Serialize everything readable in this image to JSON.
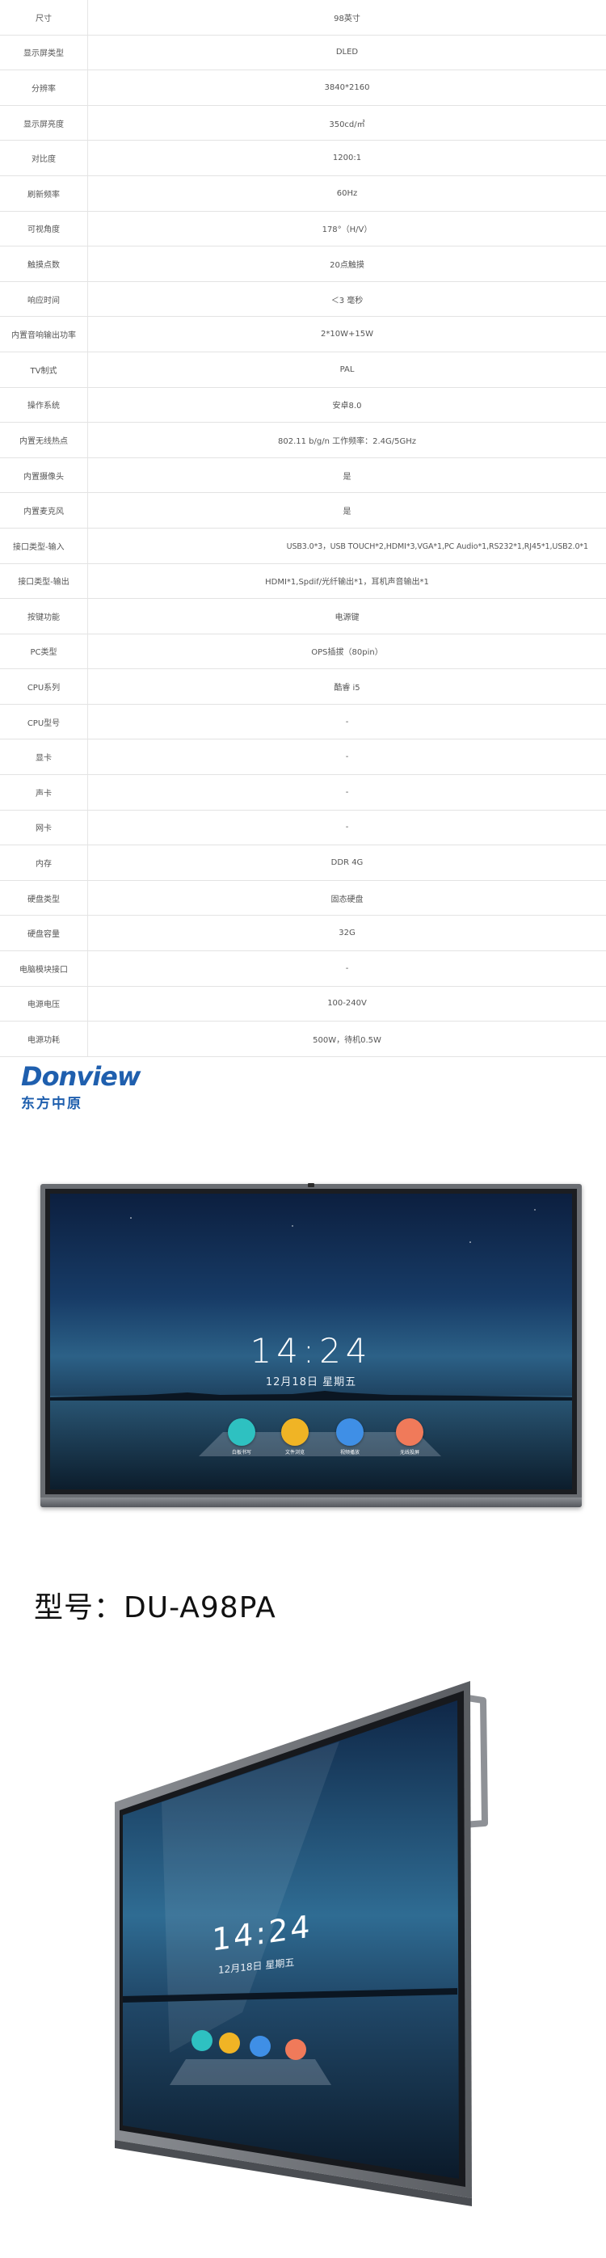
{
  "specs": [
    {
      "key": "尺寸",
      "value": "98英寸"
    },
    {
      "key": "显示屏类型",
      "value": "DLED"
    },
    {
      "key": "分辨率",
      "value": "3840*2160"
    },
    {
      "key": "显示屏亮度",
      "value": "350cd/㎡"
    },
    {
      "key": "对比度",
      "value": "1200:1"
    },
    {
      "key": "刷新频率",
      "value": "60Hz"
    },
    {
      "key": "可视角度",
      "value": "178°（H/V）"
    },
    {
      "key": "触摸点数",
      "value": "20点触摸"
    },
    {
      "key": "响应时间",
      "value": "＜3 毫秒"
    },
    {
      "key": "内置音响输出功率",
      "value": "2*10W+15W"
    },
    {
      "key": "TV制式",
      "value": "PAL"
    },
    {
      "key": "操作系统",
      "value": "安卓8.0"
    },
    {
      "key": "内置无线热点",
      "value": "802.11 b/g/n 工作频率：2.4G/5GHz"
    },
    {
      "key": "内置摄像头",
      "value": "是"
    },
    {
      "key": "内置麦克风",
      "value": "是"
    },
    {
      "key": "接口类型-输入",
      "value": "USB3.0*3，USB TOUCH*2,HDMI*3,VGA*1,PC Audio*1,RS232*1,RJ45*1,USB2.0*1"
    },
    {
      "key": "接口类型-输出",
      "value": "HDMI*1,Spdif/光纤输出*1，耳机声音输出*1"
    },
    {
      "key": "按键功能",
      "value": "电源键"
    },
    {
      "key": "PC类型",
      "value": "OPS插拔（80pin）"
    },
    {
      "key": "CPU系列",
      "value": "酷睿 i5"
    },
    {
      "key": "CPU型号",
      "value": "-"
    },
    {
      "key": "显卡",
      "value": "-"
    },
    {
      "key": "声卡",
      "value": "-"
    },
    {
      "key": "网卡",
      "value": "-"
    },
    {
      "key": "内存",
      "value": "DDR 4G"
    },
    {
      "key": "硬盘类型",
      "value": "固态硬盘"
    },
    {
      "key": "硬盘容量",
      "value": "32G"
    },
    {
      "key": "电脑模块接口",
      "value": "-"
    },
    {
      "key": "电源电压",
      "value": "100-240V"
    },
    {
      "key": "电源功耗",
      "value": "500W，待机0.5W"
    }
  ],
  "logo": {
    "word": "Donview",
    "cn": "东方中原"
  },
  "front_screen": {
    "time": "14:24",
    "date": "12月18日 星期五",
    "apps": [
      {
        "label": "白板书写",
        "color": "#2ec1c1"
      },
      {
        "label": "文件浏览",
        "color": "#f0b425"
      },
      {
        "label": "视频播放",
        "color": "#3f8fe6"
      },
      {
        "label": "无线投屏",
        "color": "#f07a5a"
      }
    ]
  },
  "model_title": "型号：DU-A98PA",
  "angled_screen": {
    "time": "14:24",
    "date": "12月18日 星期五"
  }
}
